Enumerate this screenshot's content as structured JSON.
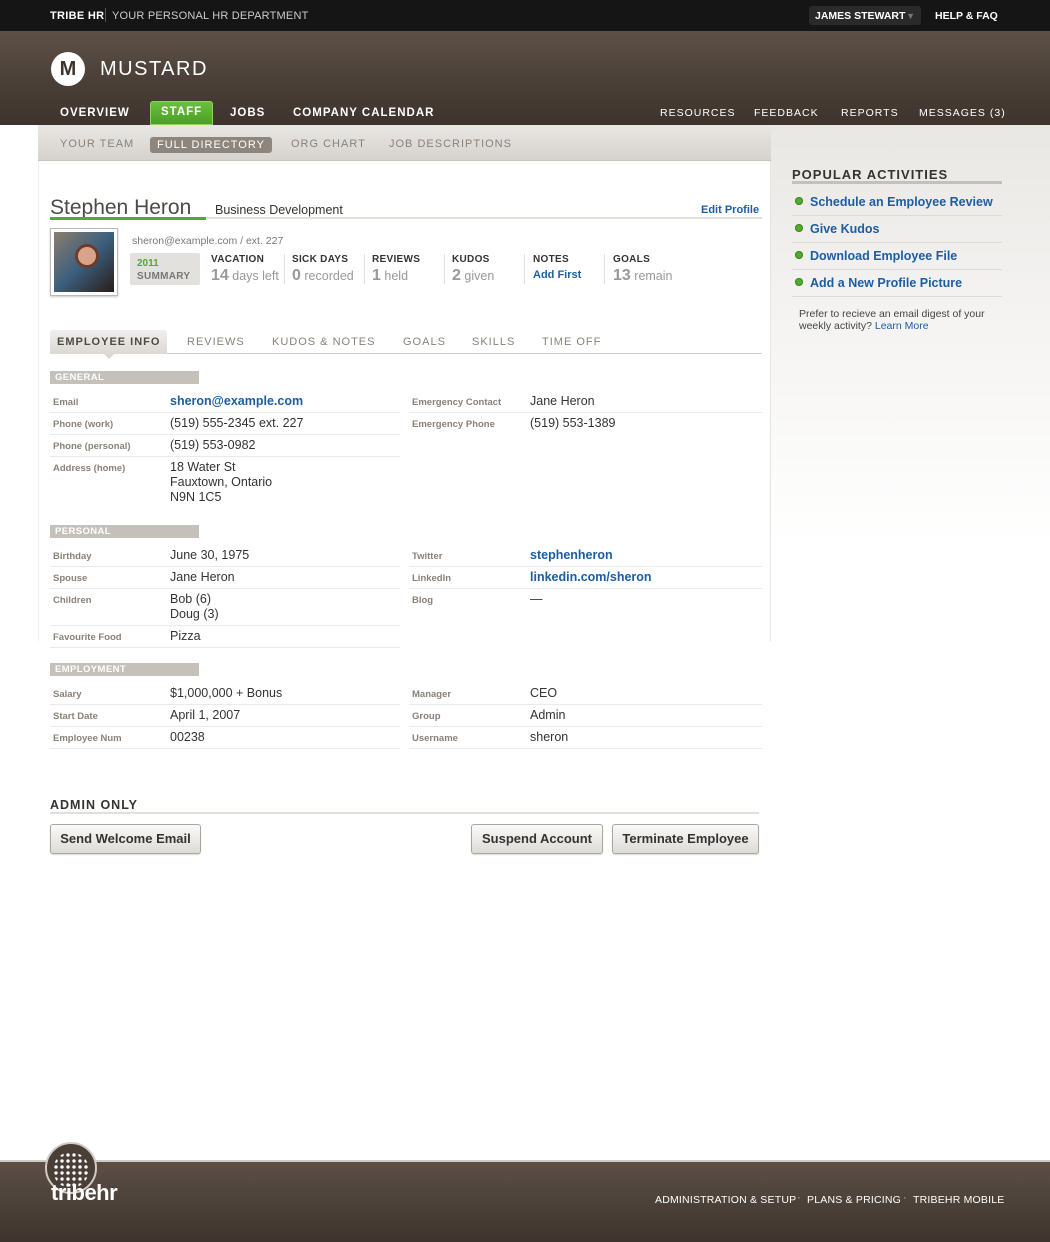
{
  "topbar": {
    "brand": "TRIBE HR",
    "tagline": "YOUR PERSONAL HR DEPARTMENT",
    "user": "JAMES STEWART",
    "help": "HELP & FAQ"
  },
  "header": {
    "logo_letter": "M",
    "company": "MUSTARD",
    "nav": [
      "OVERVIEW",
      "STAFF",
      "JOBS",
      "COMPANY CALENDAR"
    ],
    "right_nav": [
      "RESOURCES",
      "FEEDBACK",
      "REPORTS",
      "MESSAGES (3)"
    ]
  },
  "subnav": [
    "YOUR TEAM",
    "FULL DIRECTORY",
    "ORG CHART",
    "JOB DESCRIPTIONS"
  ],
  "profile": {
    "name": "Stephen Heron",
    "department": "Business Development",
    "edit_label": "Edit Profile",
    "contact_line": "sheron@example.com  /  ext. 227",
    "summary_year": "2011",
    "summary_label": "SUMMARY",
    "stats": [
      {
        "label": "VACATION",
        "num": "14",
        "rest": "days left"
      },
      {
        "label": "SICK DAYS",
        "num": "0",
        "rest": "recorded"
      },
      {
        "label": "REVIEWS",
        "num": "1",
        "rest": "held"
      },
      {
        "label": "KUDOS",
        "num": "2",
        "rest": "given"
      },
      {
        "label": "NOTES",
        "link": "Add First"
      },
      {
        "label": "GOALS",
        "num": "13",
        "rest": "remain"
      }
    ]
  },
  "tabs": [
    "EMPLOYEE INFO",
    "REVIEWS",
    "KUDOS & NOTES",
    "GOALS",
    "SKILLS",
    "TIME OFF"
  ],
  "sections": {
    "general": {
      "label": "GENERAL",
      "left": [
        {
          "key": "Email",
          "value": "sheron@example.com"
        },
        {
          "key": "Phone (work)",
          "value": "(519) 555-2345 ext. 227"
        },
        {
          "key": "Phone (personal)",
          "value": "(519) 553-0982"
        },
        {
          "key": "Address (home)",
          "lines": [
            "18 Water St",
            "Fauxtown, Ontario",
            "N9N 1C5"
          ]
        }
      ],
      "right": [
        {
          "key": "Emergency Contact",
          "value": "Jane Heron"
        },
        {
          "key": "Emergency Phone",
          "value": "(519) 553-1389"
        }
      ]
    },
    "personal": {
      "label": "PERSONAL",
      "left": [
        {
          "key": "Birthday",
          "value": "June 30, 1975"
        },
        {
          "key": "Spouse",
          "value": "Jane Heron"
        },
        {
          "key": "Children",
          "lines": [
            "Bob (6)",
            "Doug (3)"
          ]
        },
        {
          "key": "Favourite Food",
          "value": "Pizza"
        }
      ],
      "right": [
        {
          "key": "Twitter",
          "value": "stephenheron"
        },
        {
          "key": "LinkedIn",
          "value": "linkedin.com/sheron"
        },
        {
          "key": "Blog",
          "value": "—"
        }
      ]
    },
    "employment": {
      "label": "EMPLOYMENT",
      "left": [
        {
          "key": "Salary",
          "value": "$1,000,000 + Bonus"
        },
        {
          "key": "Start Date",
          "value": "April 1, 2007"
        },
        {
          "key": "Employee Num",
          "value": "00238"
        }
      ],
      "right": [
        {
          "key": "Manager",
          "value": "CEO"
        },
        {
          "key": "Group",
          "value": "Admin"
        },
        {
          "key": "Username",
          "value": "sheron"
        }
      ]
    }
  },
  "admin": {
    "title": "ADMIN ONLY",
    "welcome": "Send Welcome Email",
    "suspend": "Suspend Account",
    "terminate": "Terminate Employee"
  },
  "sidebar": {
    "title": "POPULAR ACTIVITIES",
    "items": [
      "Schedule an Employee Review",
      "Give Kudos",
      "Download Employee File",
      "Add a New Profile Picture"
    ],
    "note": "Prefer to recieve an email digest of your weekly activity?",
    "note_link": "Learn More"
  },
  "footer": {
    "logo": "tribehr",
    "links": [
      "ADMINISTRATION & SETUP",
      "PLANS & PRICING",
      "TRIBEHR MOBILE"
    ]
  },
  "colors": {
    "accent": "#55a830",
    "link": "#1c5da3",
    "header": "#4a3f37"
  }
}
